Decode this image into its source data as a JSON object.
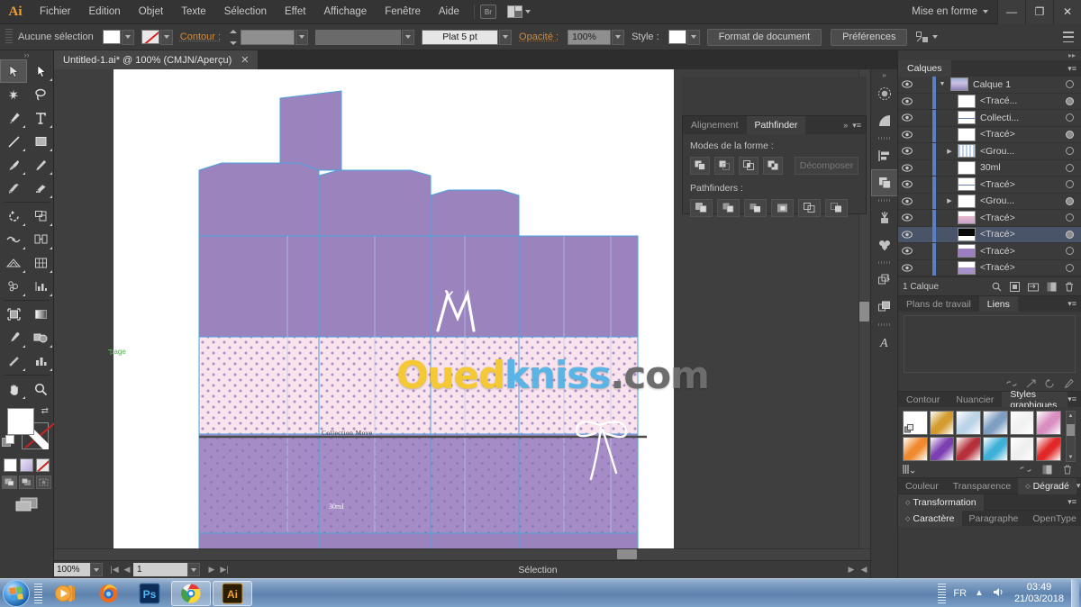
{
  "titlebar": {
    "app_logo": "Ai",
    "menus": [
      "Fichier",
      "Edition",
      "Objet",
      "Texte",
      "Sélection",
      "Effet",
      "Affichage",
      "Fenêtre",
      "Aide"
    ],
    "bridge_label": "Br",
    "workspace": "Mise en forme",
    "window_buttons": {
      "minimize": "—",
      "restore": "❐",
      "close": "✕"
    }
  },
  "controlbar": {
    "selection_status": "Aucune sélection",
    "fill_swatch": "white-swatch",
    "stroke_swatch": "none-swatch",
    "stroke_label": "Contour :",
    "stroke_weight": "",
    "stroke_profile": "",
    "stroke_style": "Plat 5 pt",
    "opacity_label": "Opacité :",
    "opacity_value": "100%",
    "style_label": "Style :",
    "doc_setup_button": "Format de document",
    "preferences_button": "Préférences"
  },
  "document_tab": {
    "title": "Untitled-1.ai* @ 100% (CMJN/Aperçu)",
    "close_glyph": "✕"
  },
  "toolbar": {
    "tools": [
      "selection-tool",
      "direct-selection-tool",
      "magic-wand-tool",
      "lasso-tool",
      "pen-tool",
      "type-tool",
      "line-segment-tool",
      "rectangle-tool",
      "paintbrush-tool",
      "pencil-tool",
      "blob-brush-tool",
      "eraser-tool",
      "rotate-tool",
      "scale-tool",
      "width-tool",
      "shape-builder-tool",
      "perspective-grid-tool",
      "graph-tool",
      "mesh-tool",
      "gradient-tool",
      "eyedropper-tool",
      "blend-tool",
      "symbol-sprayer-tool",
      "column-graph-tool",
      "artboard-tool",
      "slice-tool",
      "hand-tool",
      "zoom-tool"
    ],
    "fill_color": "#ffffff",
    "stroke_color": "none",
    "color_modes": [
      "color-mode",
      "gradient-mode",
      "none-mode"
    ],
    "draw_modes": [
      "draw-normal",
      "draw-behind",
      "draw-inside"
    ],
    "screen_mode": "screen-mode-toggle"
  },
  "canvas": {
    "page_label": "page",
    "artwork": {
      "brand_monogram": "M",
      "collection_text": "Collection Move",
      "volume_text": "30ml",
      "fill_purple": "#9b83bd",
      "fill_purple_light": "#a58cc6",
      "fill_pink": "#f9e3ec",
      "guide_color": "#4aa3df"
    },
    "watermark": {
      "part1": "Oued",
      "part1_color": "#f5c935",
      "part2": "kniss",
      "part2_color": "#5ab4e5",
      "part3": ".com",
      "part3_color": "#6d6d6d"
    }
  },
  "statusbar": {
    "zoom": "100%",
    "page_number": "1",
    "status_text": "Sélection"
  },
  "icondock": {
    "icons": [
      "brushes-icon",
      "gradient-icon",
      "align-icon",
      "pathfinder-icon",
      "symbols-icon",
      "swatches-icon",
      "appearance-icon",
      "graphic-styles-icon",
      "character-icon"
    ],
    "collapse_glyph": "»"
  },
  "pathfinder_panel": {
    "tabs": [
      "Alignement",
      "Pathfinder"
    ],
    "active_tab": "Pathfinder",
    "shape_modes_label": "Modes de la forme :",
    "shape_mode_buttons": [
      "unite-icon",
      "minus-front-icon",
      "intersect-icon",
      "exclude-icon"
    ],
    "expand_button": "Décomposer",
    "pathfinders_label": "Pathfinders :",
    "pathfinder_buttons": [
      "divide-icon",
      "trim-icon",
      "merge-icon",
      "crop-icon",
      "outline-icon",
      "minus-back-icon"
    ],
    "menu_glyph": "▾≡",
    "collapse_glyph": "»"
  },
  "layers_panel": {
    "tab": "Calques",
    "menu_glyph": "▾≡",
    "rows": [
      {
        "name": "Calque 1",
        "indent": 0,
        "has_triangle": true,
        "expanded": true,
        "target_filled": false,
        "selected": false,
        "thumb": "layer-thumb-blue"
      },
      {
        "name": "<Tracé...",
        "indent": 1,
        "has_triangle": false,
        "expanded": false,
        "target_filled": true,
        "selected": false,
        "thumb": "layer-thumb-sketch"
      },
      {
        "name": "Collecti...",
        "indent": 1,
        "has_triangle": false,
        "expanded": false,
        "target_filled": false,
        "selected": false,
        "thumb": "layer-thumb-lines"
      },
      {
        "name": "<Tracé>",
        "indent": 1,
        "has_triangle": false,
        "expanded": false,
        "target_filled": true,
        "selected": false,
        "thumb": "layer-thumb-blank"
      },
      {
        "name": "<Grou...",
        "indent": 1,
        "has_triangle": true,
        "expanded": false,
        "target_filled": false,
        "selected": false,
        "thumb": "layer-thumb-grid"
      },
      {
        "name": "30ml",
        "indent": 1,
        "has_triangle": false,
        "expanded": false,
        "target_filled": false,
        "selected": false,
        "thumb": "layer-thumb-blank"
      },
      {
        "name": "<Tracé>",
        "indent": 1,
        "has_triangle": false,
        "expanded": false,
        "target_filled": false,
        "selected": false,
        "thumb": "layer-thumb-lines"
      },
      {
        "name": "<Grou...",
        "indent": 1,
        "has_triangle": true,
        "expanded": false,
        "target_filled": true,
        "selected": false,
        "thumb": "layer-thumb-blank"
      },
      {
        "name": "<Tracé>",
        "indent": 1,
        "has_triangle": false,
        "expanded": false,
        "target_filled": false,
        "selected": false,
        "thumb": "layer-thumb-pink"
      },
      {
        "name": "<Tracé>",
        "indent": 1,
        "has_triangle": false,
        "expanded": false,
        "target_filled": true,
        "selected": true,
        "thumb": "layer-thumb-black"
      },
      {
        "name": "<Tracé>",
        "indent": 1,
        "has_triangle": false,
        "expanded": false,
        "target_filled": false,
        "selected": false,
        "thumb": "layer-thumb-purple"
      },
      {
        "name": "<Tracé>",
        "indent": 1,
        "has_triangle": false,
        "expanded": false,
        "target_filled": false,
        "selected": false,
        "thumb": "layer-thumb-purple2"
      }
    ],
    "footer_count": "1 Calque",
    "footer_icons": [
      "locate-object-icon",
      "make-mask-icon",
      "create-sublayer-icon",
      "new-layer-icon",
      "delete-layer-icon"
    ]
  },
  "links_panel": {
    "tabs": [
      "Plans de travail",
      "Liens"
    ],
    "active_tab": "Liens",
    "menu_glyph": "▾≡",
    "footer_icons": [
      "relink-icon",
      "goto-link-icon",
      "update-link-icon",
      "edit-original-icon"
    ]
  },
  "graphic_styles_panel": {
    "tabs": [
      "Contour",
      "Nuancier",
      "Styles graphiques"
    ],
    "active_tab": "Styles graphiques",
    "menu_glyph": "▾≡",
    "swatches": [
      {
        "name": "default-style",
        "color": "#ffffff"
      },
      {
        "name": "gold-gradient-style",
        "color": "#d39b2e"
      },
      {
        "name": "blue-soft-style",
        "color": "#bcd4e8"
      },
      {
        "name": "blue-bevel-style",
        "color": "#7e9ec2"
      },
      {
        "name": "white-gloss-style",
        "color": "#f2f2f2"
      },
      {
        "name": "pink-gradient-style",
        "color": "#d98fc2"
      },
      {
        "name": "orange-gradient-style",
        "color": "#f08a2e"
      },
      {
        "name": "purple-texture-style",
        "color": "#7b3fb0"
      },
      {
        "name": "red-texture-style",
        "color": "#b5303a"
      },
      {
        "name": "cyan-dots-style",
        "color": "#3fb0d8"
      },
      {
        "name": "red-glyph-style",
        "color": "#f0f0f0"
      },
      {
        "name": "red-solid-style",
        "color": "#e02828"
      }
    ],
    "footer_icons": [
      "style-library-icon",
      "break-link-icon",
      "new-style-icon",
      "delete-style-icon"
    ]
  },
  "bottom_panels": {
    "color_group": {
      "tabs": [
        "Couleur",
        "Transparence",
        "Dégradé"
      ],
      "active_tab": "Dégradé"
    },
    "transform": {
      "title": "Transformation"
    },
    "type_group": {
      "tabs": [
        "Caractère",
        "Paragraphe",
        "OpenType"
      ],
      "active_tab": "Caractère"
    }
  },
  "taskbar": {
    "start_button": "windows-start-orb",
    "items": [
      "media-player-icon",
      "firefox-icon",
      "photoshop-icon",
      "chrome-icon",
      "illustrator-icon"
    ],
    "open_items": [
      "chrome-icon",
      "illustrator-icon"
    ],
    "tray": {
      "language": "FR",
      "show_hidden": "▲",
      "volume": "volume-icon",
      "time": "03:49",
      "date": "21/03/2018"
    }
  }
}
